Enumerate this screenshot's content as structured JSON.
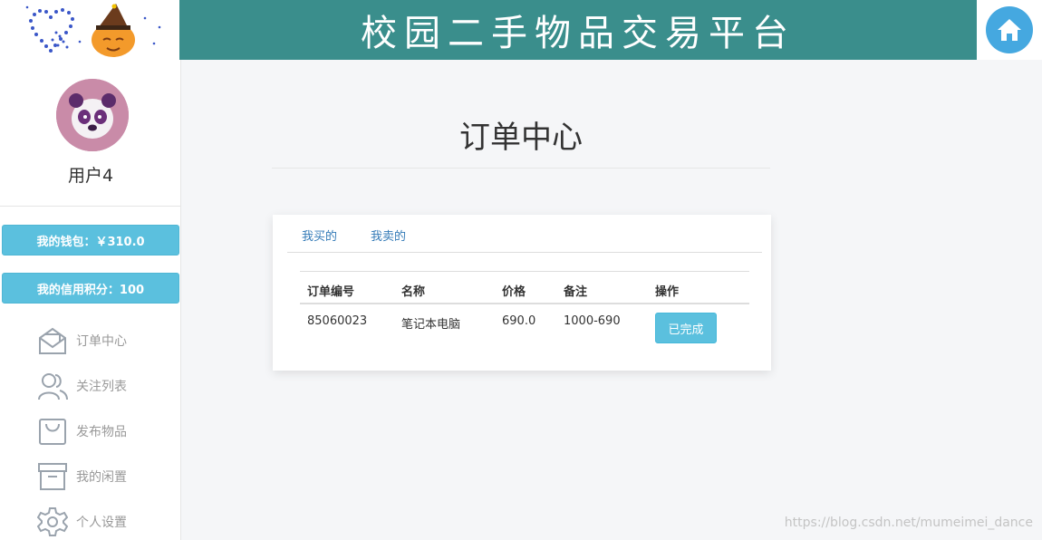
{
  "header": {
    "title": "校园二手物品交易平台",
    "home_icon": "home-icon"
  },
  "sidebar": {
    "username": "用户4",
    "wallet": "我的钱包：￥310.0",
    "credit": "我的信用积分：100",
    "nav": [
      {
        "label": "订单中心",
        "icon": "envelope-icon"
      },
      {
        "label": "关注列表",
        "icon": "users-icon"
      },
      {
        "label": "发布物品",
        "icon": "bag-icon"
      },
      {
        "label": "我的闲置",
        "icon": "archive-icon"
      },
      {
        "label": "个人设置",
        "icon": "gear-icon"
      }
    ]
  },
  "main": {
    "title": "订单中心",
    "tabs": [
      "我买的",
      "我卖的"
    ],
    "table": {
      "headers": [
        "订单编号",
        "名称",
        "价格",
        "备注",
        "操作"
      ],
      "rows": [
        {
          "id": "85060023",
          "name": "笔记本电脑",
          "price": "690.0",
          "note": "1000-690",
          "action": "已完成"
        }
      ]
    }
  },
  "watermark": "https://blog.csdn.net/mumeimei_dance",
  "colors": {
    "banner": "#3a8e8c",
    "accent": "#5bc0de",
    "link": "#337ab7",
    "home": "#45a8e0"
  }
}
